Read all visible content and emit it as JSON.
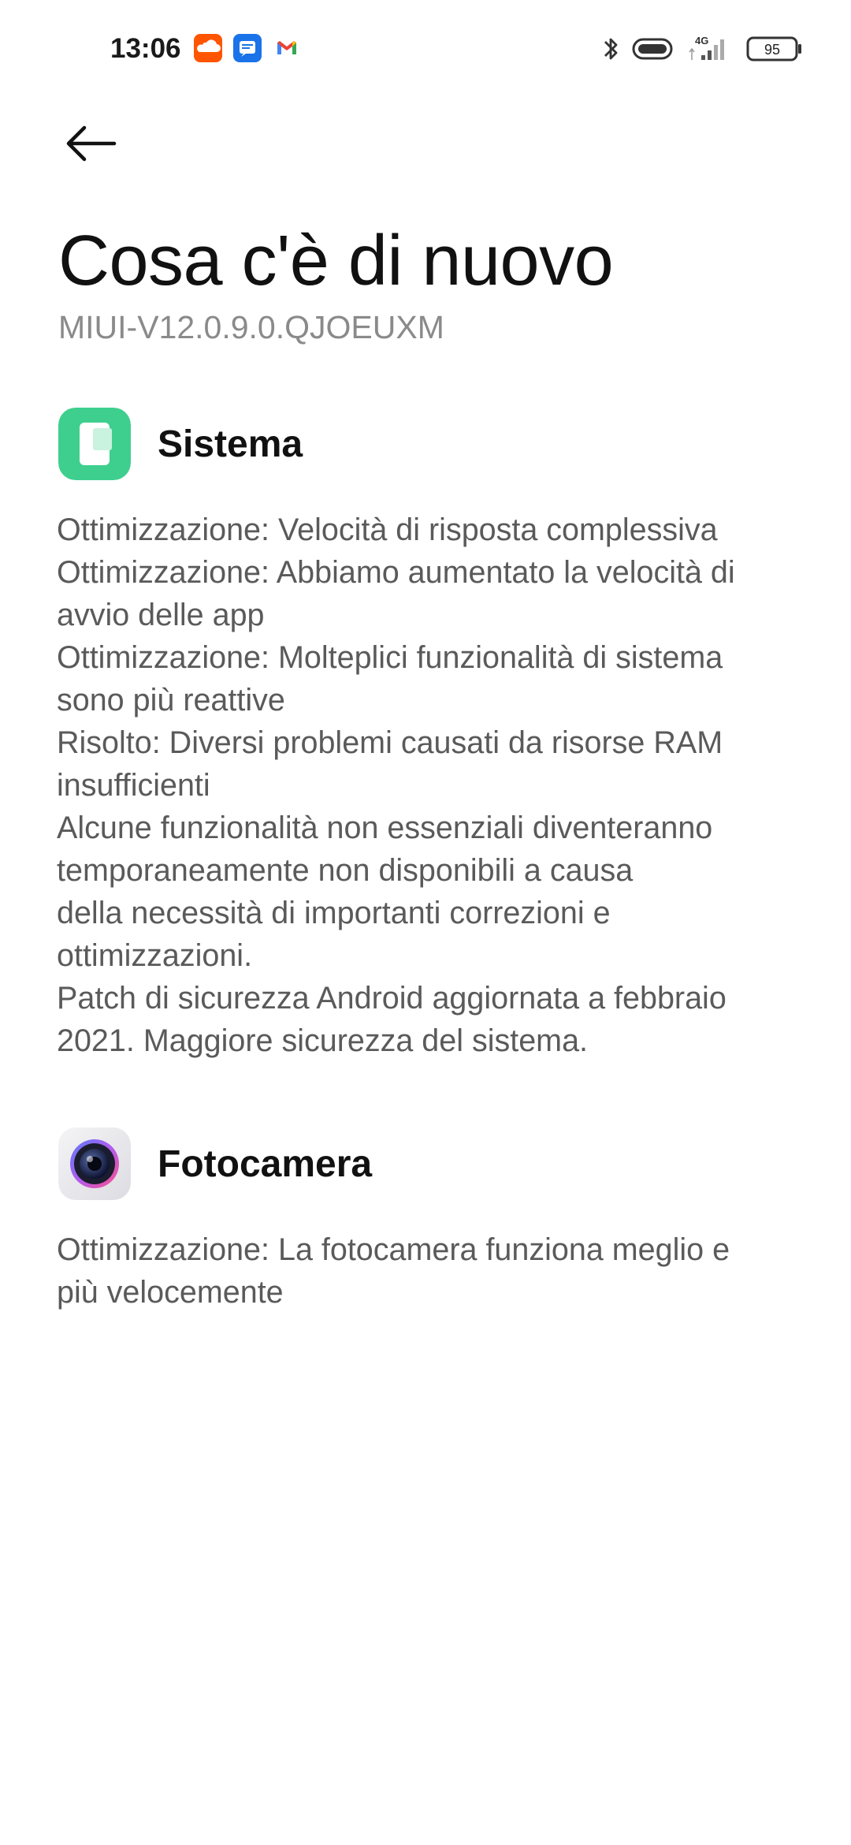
{
  "status_bar": {
    "time": "13:06",
    "notifications": [
      "soundcloud-icon",
      "messages-icon",
      "gmail-icon"
    ],
    "network_type": "4G",
    "battery_level": "95"
  },
  "header": {
    "back_icon": "arrow-left-icon",
    "title": "Cosa c'è di nuovo",
    "version": "MIUI-V12.0.9.0.QJOEUXM"
  },
  "sections": [
    {
      "title": "Sistema",
      "icon": "system-app-icon",
      "icon_color": "#3ecf8e",
      "lines": [
        "Ottimizzazione: Velocità di risposta complessiva",
        "Ottimizzazione: Abbiamo aumentato la velocità di",
        "avvio delle app",
        "Ottimizzazione: Molteplici funzionalità di sistema",
        "sono più reattive",
        "Risolto: Diversi problemi causati da risorse RAM",
        "insufficienti",
        "Alcune funzionalità non essenziali diventeranno",
        "temporaneamente non disponibili a causa",
        "della necessità di importanti correzioni e",
        "ottimizzazioni.",
        "Patch di sicurezza Android aggiornata a febbraio",
        "2021. Maggiore sicurezza del sistema."
      ]
    },
    {
      "title": "Fotocamera",
      "icon": "camera-app-icon",
      "lines": [
        "Ottimizzazione: La fotocamera funziona meglio e",
        "più velocemente"
      ]
    }
  ],
  "colors": {
    "background": "#ffffff",
    "title_text": "#111111",
    "version_text": "#8a8a8a",
    "body_text": "#5a5a5a",
    "sistema_icon": "#3ecf8e",
    "soundcloud": "#ff5500",
    "messages": "#1a73e8"
  }
}
